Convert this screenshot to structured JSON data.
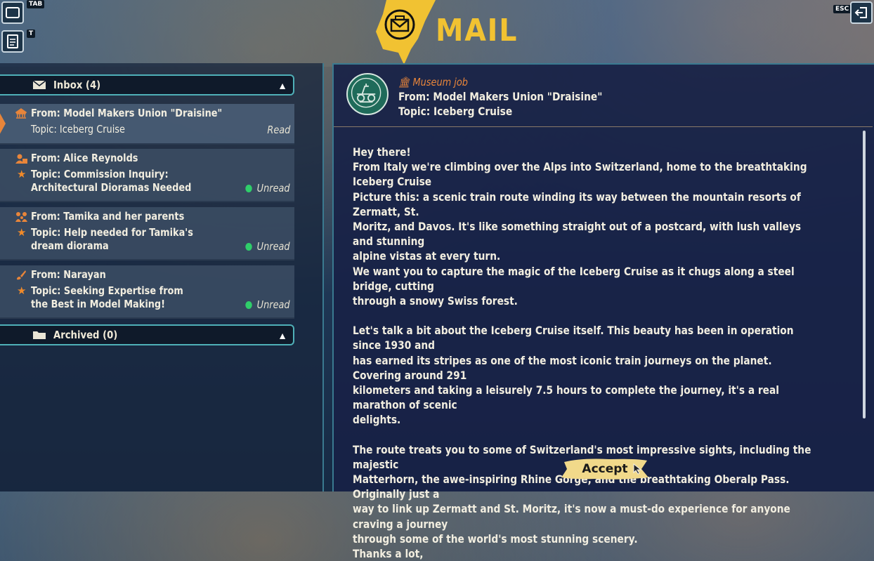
{
  "header": {
    "title": "MAIL"
  },
  "hotkeys": {
    "tab": "TAB",
    "t": "T",
    "esc": "ESC"
  },
  "inbox": {
    "label": "Inbox (4)",
    "items": [
      {
        "from": "From: Model Makers Union \"Draisine\"",
        "topic": "Topic: Iceberg Cruise",
        "topic2": "",
        "status": "Read",
        "icon": "museum-icon",
        "starred": false,
        "selected": true
      },
      {
        "from": "From: Alice Reynolds",
        "topic": "Topic: Commission Inquiry:",
        "topic2": "Architectural Dioramas Needed",
        "status": "Unread",
        "icon": "person-icon",
        "starred": true,
        "selected": false
      },
      {
        "from": "From: Tamika and her parents",
        "topic": "Topic: Help needed for Tamika's",
        "topic2": "dream diorama",
        "status": "Unread",
        "icon": "family-icon",
        "starred": true,
        "selected": false
      },
      {
        "from": "From: Narayan",
        "topic": "Topic: Seeking Expertise from",
        "topic2": "the Best in Model Making!",
        "status": "Unread",
        "icon": "brush-icon",
        "starred": true,
        "selected": false
      }
    ]
  },
  "archived": {
    "label": "Archived (0)"
  },
  "message": {
    "tag": "Museum job",
    "from": "From: Model Makers Union \"Draisine\"",
    "topic": "Topic: Iceberg Cruise",
    "paragraphs": [
      [
        "Hey there!",
        "From Italy we're climbing over the Alps into Switzerland, home to the breathtaking Iceberg Cruise",
        "Picture this: a scenic train route winding its way between the mountain resorts of Zermatt, St.",
        "Moritz, and Davos. It's like something straight out of a postcard, with lush valleys and stunning",
        "alpine vistas at every turn.",
        "We want you to capture the magic of the  Iceberg Cruise  as it chugs along a steel bridge, cutting",
        "through a snowy Swiss forest."
      ],
      [
        "Let's talk a bit about the  Iceberg Cruise  itself. This beauty has been in operation since 1930 and",
        "has earned its stripes as one of the most iconic train journeys on the planet. Covering around 291",
        "kilometers and taking a leisurely 7.5 hours to complete the journey, it's a real marathon of scenic",
        "delights."
      ],
      [
        "The route treats you to some of Switzerland's most impressive sights, including the majestic",
        "Matterhorn, the awe-inspiring Rhine Gorge, and the breathtaking Oberalp Pass. Originally just a",
        "way to link up Zermatt and St. Moritz, it's now a must-do experience for anyone craving a journey",
        "through some of the world's most stunning scenery.",
        "Thanks a lot,"
      ]
    ],
    "accept_label": "Accept"
  },
  "colors": {
    "accent": "#f1c232",
    "unread_dot": "#2fce6a",
    "tag": "#e8853a",
    "frame": "#4fb0b8"
  }
}
